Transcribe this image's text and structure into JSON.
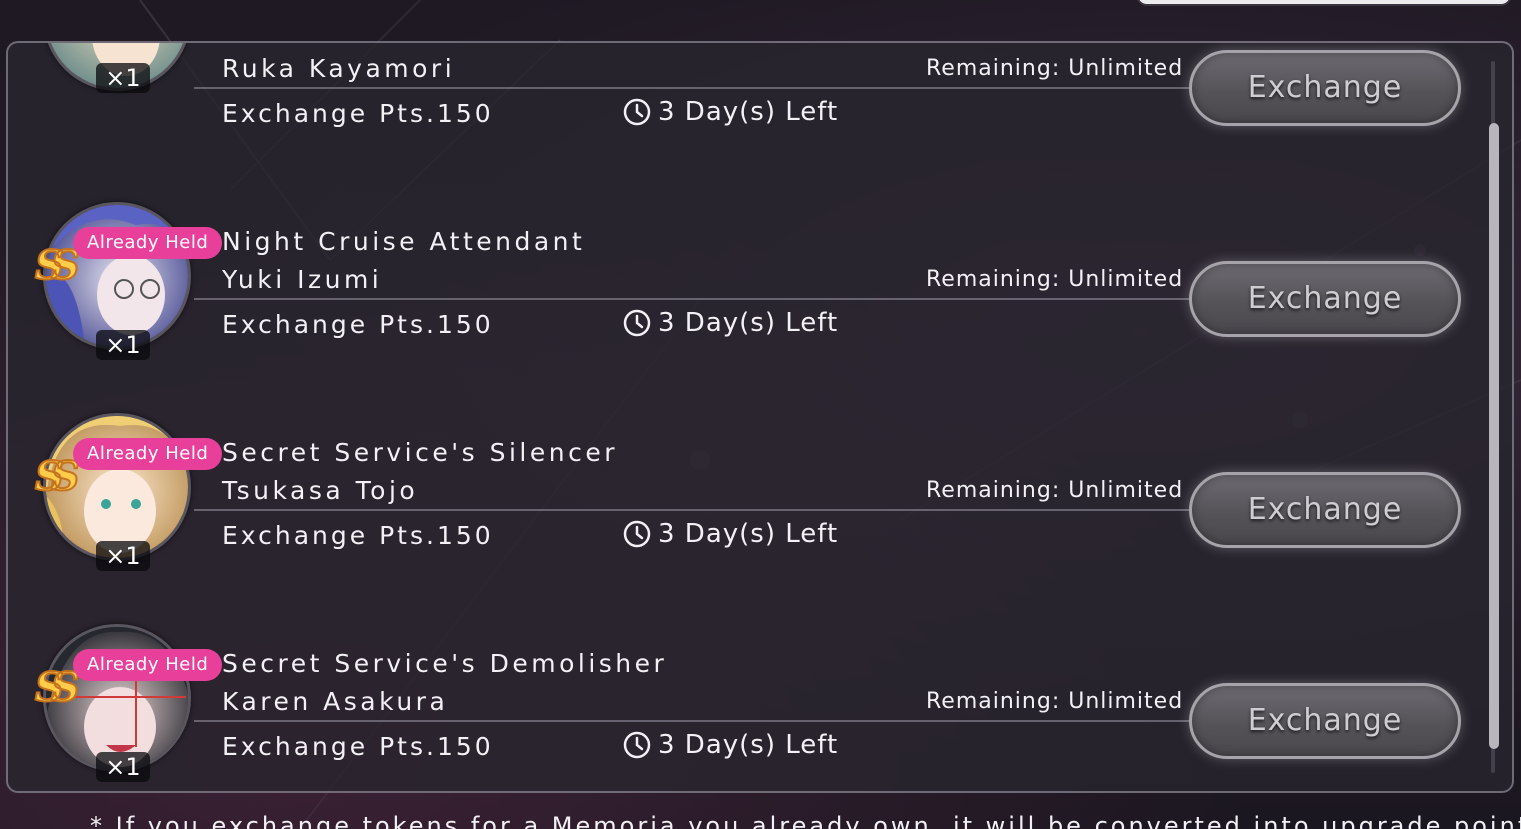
{
  "colors": {
    "badge": "#e8409a",
    "rarity_fill": "#ffcd4a",
    "button_gray": "#5c5a60"
  },
  "rows": [
    {
      "name_line1": "Ruka Kayamori",
      "name_line2": "",
      "points": "Exchange Pts.150",
      "time_left": "3 Day(s) Left",
      "remaining": "Remaining: Unlimited",
      "exchange_label": "Exchange",
      "quantity": "×1",
      "held_badge": "",
      "rarity": ""
    },
    {
      "name_line1": "Night Cruise Attendant",
      "name_line2": "Yuki Izumi",
      "points": "Exchange Pts.150",
      "time_left": "3 Day(s) Left",
      "remaining": "Remaining: Unlimited",
      "exchange_label": "Exchange",
      "quantity": "×1",
      "held_badge": "Already Held",
      "rarity": "SS"
    },
    {
      "name_line1": "Secret Service's Silencer",
      "name_line2": "Tsukasa Tojo",
      "points": "Exchange Pts.150",
      "time_left": "3 Day(s) Left",
      "remaining": "Remaining: Unlimited",
      "exchange_label": "Exchange",
      "quantity": "×1",
      "held_badge": "Already Held",
      "rarity": "SS"
    },
    {
      "name_line1": "Secret Service's Demolisher",
      "name_line2": "Karen Asakura",
      "points": "Exchange Pts.150",
      "time_left": "3 Day(s) Left",
      "remaining": "Remaining: Unlimited",
      "exchange_label": "Exchange",
      "quantity": "×1",
      "held_badge": "Already Held",
      "rarity": "SS"
    }
  ],
  "footer_note": "* If you exchange tokens for a Memoria you already own, it will be converted into upgrade points and"
}
